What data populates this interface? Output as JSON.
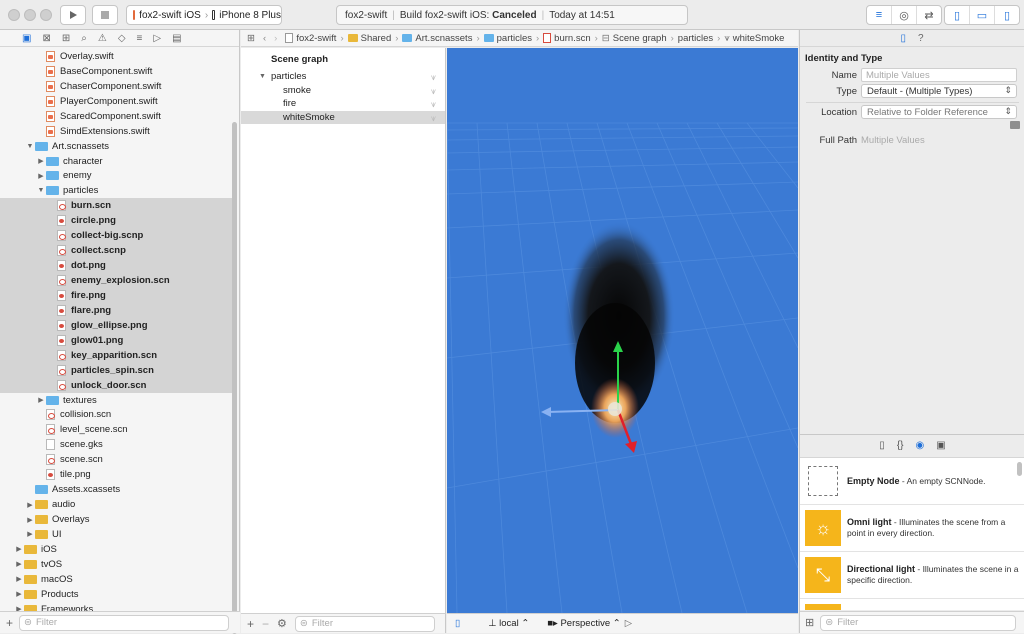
{
  "window": {
    "scheme": "fox2-swift iOS",
    "device": "iPhone 8 Plus",
    "activity_project": "fox2-swift",
    "activity_status_prefix": "Build fox2-swift iOS:",
    "activity_status": "Canceled",
    "activity_time": "Today at 14:51"
  },
  "navigator": {
    "filter_placeholder": "Filter",
    "items": [
      {
        "label": "Overlay.swift",
        "depth": 2,
        "kind": "swift"
      },
      {
        "label": "BaseComponent.swift",
        "depth": 2,
        "kind": "swift"
      },
      {
        "label": "ChaserComponent.swift",
        "depth": 2,
        "kind": "swift"
      },
      {
        "label": "PlayerComponent.swift",
        "depth": 2,
        "kind": "swift"
      },
      {
        "label": "ScaredComponent.swift",
        "depth": 2,
        "kind": "swift"
      },
      {
        "label": "SimdExtensions.swift",
        "depth": 2,
        "kind": "swift"
      },
      {
        "label": "Art.scnassets",
        "depth": 1,
        "kind": "folder",
        "open": true
      },
      {
        "label": "character",
        "depth": 2,
        "kind": "folder"
      },
      {
        "label": "enemy",
        "depth": 2,
        "kind": "folder"
      },
      {
        "label": "particles",
        "depth": 2,
        "kind": "folder",
        "open": true
      },
      {
        "label": "burn.scn",
        "depth": 3,
        "kind": "red",
        "selected": true,
        "bold": true
      },
      {
        "label": "circle.png",
        "depth": 3,
        "kind": "img",
        "selected": true,
        "bold": true
      },
      {
        "label": "collect-big.scnp",
        "depth": 3,
        "kind": "red",
        "selected": true,
        "bold": true
      },
      {
        "label": "collect.scnp",
        "depth": 3,
        "kind": "red",
        "selected": true,
        "bold": true
      },
      {
        "label": "dot.png",
        "depth": 3,
        "kind": "img",
        "selected": true,
        "bold": true
      },
      {
        "label": "enemy_explosion.scn",
        "depth": 3,
        "kind": "red",
        "selected": true,
        "bold": true
      },
      {
        "label": "fire.png",
        "depth": 3,
        "kind": "img",
        "selected": true,
        "bold": true
      },
      {
        "label": "flare.png",
        "depth": 3,
        "kind": "img",
        "selected": true,
        "bold": true
      },
      {
        "label": "glow_ellipse.png",
        "depth": 3,
        "kind": "img",
        "selected": true,
        "bold": true
      },
      {
        "label": "glow01.png",
        "depth": 3,
        "kind": "img",
        "selected": true,
        "bold": true
      },
      {
        "label": "key_apparition.scn",
        "depth": 3,
        "kind": "red",
        "selected": true,
        "bold": true
      },
      {
        "label": "particles_spin.scn",
        "depth": 3,
        "kind": "red",
        "selected": true,
        "bold": true
      },
      {
        "label": "unlock_door.scn",
        "depth": 3,
        "kind": "red",
        "selected": true,
        "bold": true
      },
      {
        "label": "textures",
        "depth": 2,
        "kind": "folder"
      },
      {
        "label": "collision.scn",
        "depth": 2,
        "kind": "red"
      },
      {
        "label": "level_scene.scn",
        "depth": 2,
        "kind": "red"
      },
      {
        "label": "scene.gks",
        "depth": 2,
        "kind": "plain"
      },
      {
        "label": "scene.scn",
        "depth": 2,
        "kind": "red"
      },
      {
        "label": "tile.png",
        "depth": 2,
        "kind": "img"
      },
      {
        "label": "Assets.xcassets",
        "depth": 1,
        "kind": "folder-blue-nodisc"
      },
      {
        "label": "audio",
        "depth": 1,
        "kind": "folder-y"
      },
      {
        "label": "Overlays",
        "depth": 1,
        "kind": "folder-y"
      },
      {
        "label": "UI",
        "depth": 1,
        "kind": "folder-y"
      },
      {
        "label": "iOS",
        "depth": 0,
        "kind": "folder-y"
      },
      {
        "label": "tvOS",
        "depth": 0,
        "kind": "folder-y"
      },
      {
        "label": "macOS",
        "depth": 0,
        "kind": "folder-y"
      },
      {
        "label": "Products",
        "depth": 0,
        "kind": "folder-y"
      },
      {
        "label": "Frameworks",
        "depth": 0,
        "kind": "folder-y"
      }
    ]
  },
  "jumpbar": {
    "crumbs": [
      "fox2-swift",
      "Shared",
      "Art.scnassets",
      "particles",
      "burn.scn",
      "Scene graph",
      "particles",
      "whiteSmoke"
    ]
  },
  "scene_graph": {
    "title": "Scene graph",
    "root": "particles",
    "children": [
      "smoke",
      "fire",
      "whiteSmoke"
    ],
    "selected": "whiteSmoke",
    "filter_placeholder": "Filter"
  },
  "viewport": {
    "space": "local",
    "camera": "Perspective",
    "background_color": "#3b7ad4"
  },
  "inspector": {
    "section_title": "Identity and Type",
    "name_label": "Name",
    "name_placeholder": "Multiple Values",
    "type_label": "Type",
    "type_value": "Default - (Multiple Types)",
    "location_label": "Location",
    "location_value": "Relative to Folder Reference",
    "fullpath_label": "Full Path",
    "fullpath_value": "Multiple Values",
    "library_filter_placeholder": "Filter",
    "library": [
      {
        "title": "Empty Node",
        "desc": " - An empty SCNNode."
      },
      {
        "title": "Omni light",
        "desc": " - Illuminates the scene from a point in every direction."
      },
      {
        "title": "Directional light",
        "desc": " - Illuminates the scene in a specific direction."
      }
    ]
  }
}
